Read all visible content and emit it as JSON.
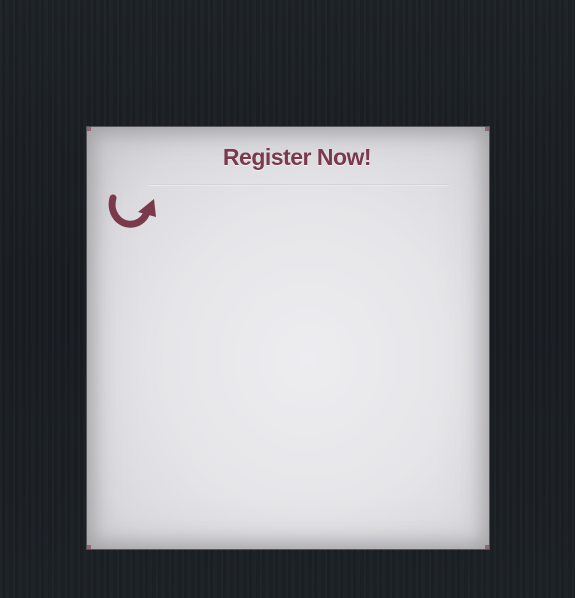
{
  "form": {
    "title": "Register Now!",
    "accent_color": "#7a3a4c",
    "arrow_icon": "curved-arrow-icon"
  },
  "background": {
    "color": "#1b1f24"
  }
}
